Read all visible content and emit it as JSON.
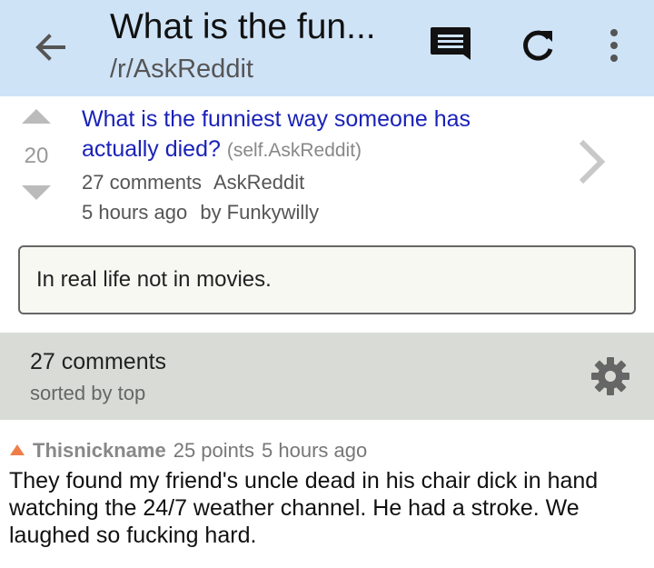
{
  "header": {
    "title": "What is the fun...",
    "subtitle": "/r/AskReddit",
    "icons": [
      "back-arrow-icon",
      "comments-icon",
      "refresh-icon",
      "more-vert-icon"
    ],
    "background": "#cfe3f7"
  },
  "post": {
    "score": "20",
    "title": "What is the funniest way someone has actually died?",
    "domain": "(self.AskReddit)",
    "comments_label": "27 comments",
    "subreddit": "AskReddit",
    "time": "5 hours ago",
    "author": "by Funkywilly",
    "selftext": "In real life not in movies.",
    "title_color": "#1a22b8"
  },
  "comments_header": {
    "count": "27 comments",
    "sort": "sorted by top"
  },
  "comments": [
    {
      "author": "Thisnickname",
      "points": "25 points",
      "time": "5 hours ago",
      "body": "They found my friend's uncle dead in his chair dick in hand watching the 24/7 weather channel. He had a stroke. We laughed so fucking hard."
    }
  ],
  "colors": {
    "upvote_accent": "#ef7d4a",
    "comments_bar": "#d9dcd6"
  }
}
